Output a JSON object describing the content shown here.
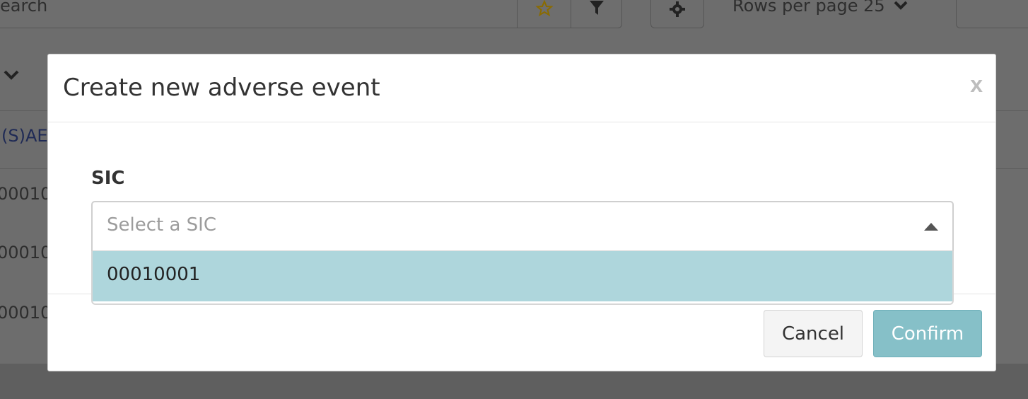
{
  "background": {
    "search_text": "earch",
    "rows_per_page": "Rows per page 25",
    "column_header": "(S)AE",
    "row_values": [
      "00010",
      "00010",
      "00010"
    ]
  },
  "modal": {
    "title": "Create new adverse event",
    "close_label": "x",
    "field_label": "SIC",
    "select_placeholder": "Select a SIC",
    "options": [
      "00010001"
    ],
    "cancel_label": "Cancel",
    "confirm_label": "Confirm"
  },
  "colors": {
    "highlight": "#aed6dc",
    "confirm_bg": "#86c0c8",
    "overlay": "#6d6d6d"
  }
}
